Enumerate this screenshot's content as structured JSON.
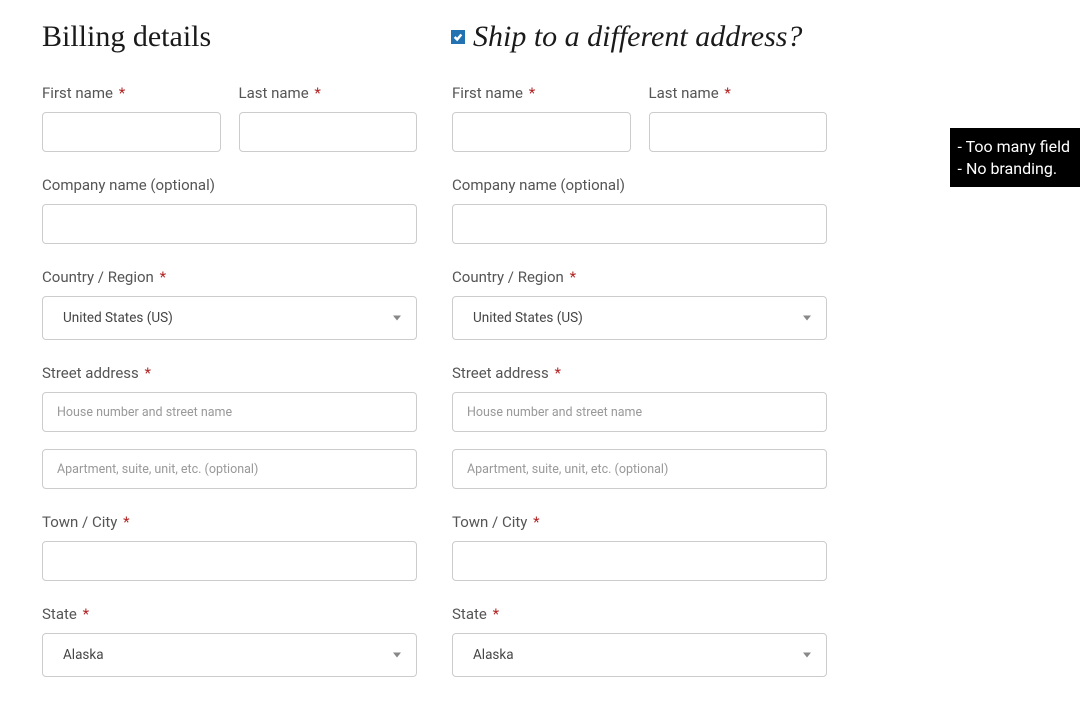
{
  "billing": {
    "title": "Billing details",
    "first_name_label": "First name",
    "last_name_label": "Last name",
    "company_label": "Company name (optional)",
    "country_label": "Country / Region",
    "country_value": "United States (US)",
    "street_label": "Street address",
    "street1_placeholder": "House number and street name",
    "street2_placeholder": "Apartment, suite, unit, etc. (optional)",
    "city_label": "Town / City",
    "state_label": "State",
    "state_value": "Alaska"
  },
  "shipping": {
    "title": "Ship to a different address?",
    "first_name_label": "First name",
    "last_name_label": "Last name",
    "company_label": "Company name (optional)",
    "country_label": "Country / Region",
    "country_value": "United States (US)",
    "street_label": "Street address",
    "street1_placeholder": "House number and street name",
    "street2_placeholder": "Apartment, suite, unit, etc. (optional)",
    "city_label": "Town / City",
    "state_label": "State",
    "state_value": "Alaska"
  },
  "annotation": {
    "line1": "- Too many field",
    "line2": "- No branding."
  },
  "asterisk": "*"
}
